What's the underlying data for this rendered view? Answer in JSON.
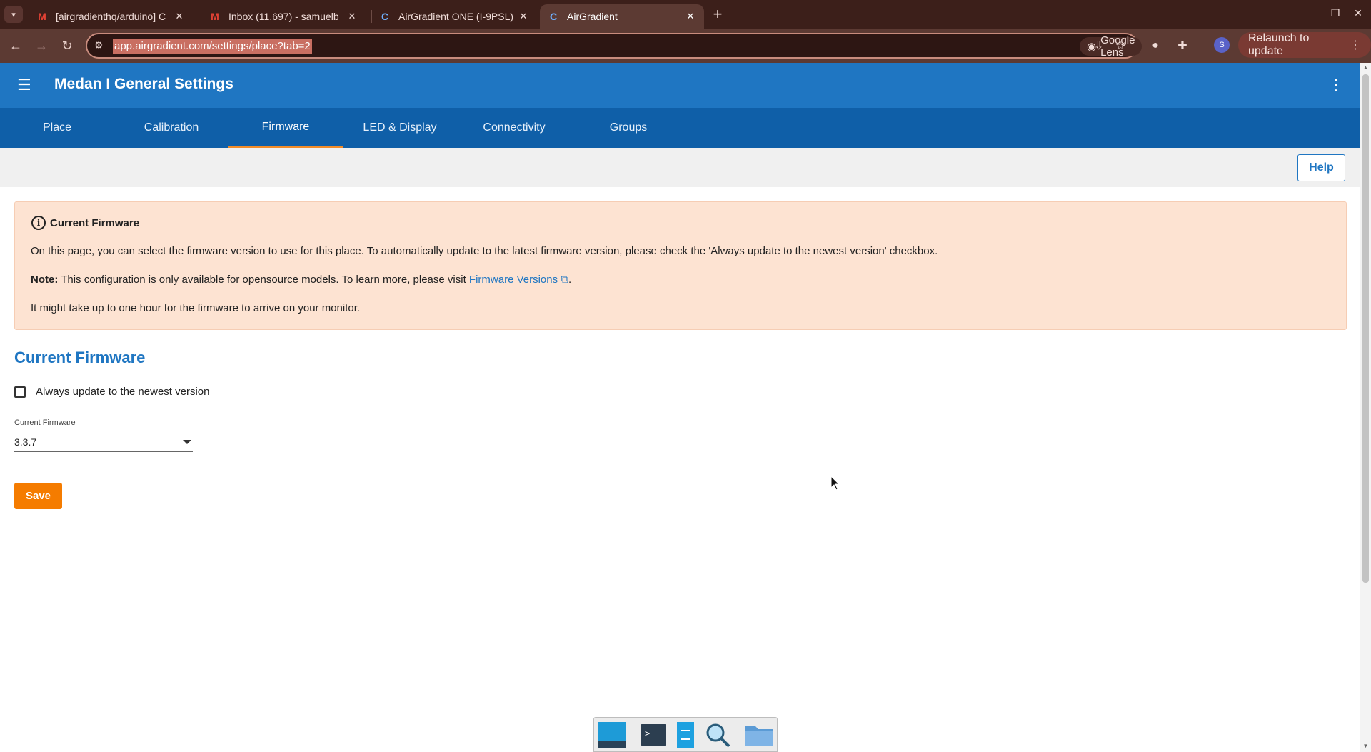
{
  "browser": {
    "tabs": [
      {
        "title": "[airgradienthq/arduino] C",
        "icon": "gmail-icon",
        "active": false
      },
      {
        "title": "Inbox (11,697) - samuelb",
        "icon": "gmail-icon",
        "active": false
      },
      {
        "title": "AirGradient ONE (I-9PSL)",
        "icon": "airgradient-icon",
        "active": false
      },
      {
        "title": "AirGradient",
        "icon": "airgradient-icon",
        "active": true
      }
    ],
    "url": "app.airgradient.com/settings/place?tab=2",
    "lens_label": "Google Lens",
    "relaunch_label": "Relaunch to update",
    "profile_initial": "S"
  },
  "app": {
    "title": "Medan I General Settings",
    "nav_tabs": [
      {
        "label": "Place",
        "active": false
      },
      {
        "label": "Calibration",
        "active": false
      },
      {
        "label": "Firmware",
        "active": true
      },
      {
        "label": "LED & Display",
        "active": false
      },
      {
        "label": "Connectivity",
        "active": false
      },
      {
        "label": "Groups",
        "active": false
      }
    ],
    "help_label": "Help",
    "notice": {
      "heading": "Current Firmware",
      "line1": "On this page, you can select the firmware version to use for this place. To automatically update to the latest firmware version, please check the 'Always update to the newest version' checkbox.",
      "note_label": "Note:",
      "note_text": " This configuration is only available for opensource models. To learn more, please visit ",
      "note_link": "Firmware Versions",
      "note_end": ".",
      "line3": "It might take up to one hour for the firmware to arrive on your monitor."
    },
    "section_title": "Current Firmware",
    "checkbox_label": "Always update to the newest version",
    "checkbox_checked": false,
    "firmware_field_label": "Current Firmware",
    "firmware_value": "3.3.7",
    "save_label": "Save"
  },
  "colors": {
    "appbar": "#1f76c2",
    "tabsbar": "#0f5fa8",
    "accent": "#f57c00",
    "notice_bg": "#fde3d2"
  }
}
